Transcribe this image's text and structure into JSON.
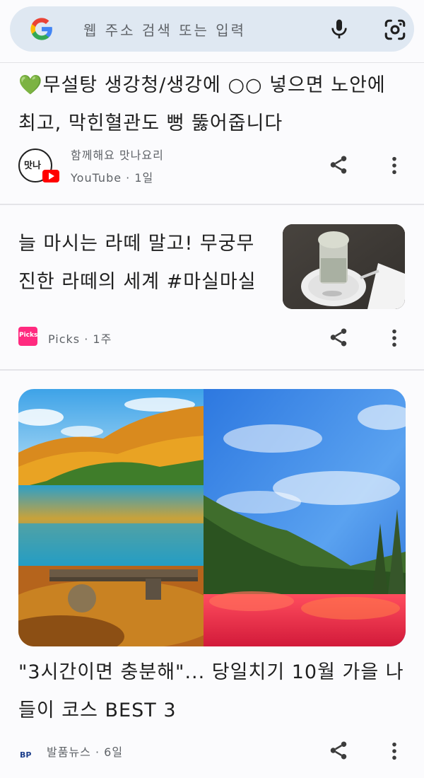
{
  "search": {
    "placeholder": "웹 주소 검색 또는 입력",
    "logo_icon": "google-g-icon",
    "mic_icon": "microphone-icon",
    "lens_icon": "camera-lens-icon"
  },
  "feed": [
    {
      "headline": "💚무설탕 생강청/생강에 ○○ 넣으면 노안에 최고, 막힌혈관도 뻥 뚫어줍니다",
      "headline_line1": "💚무설탕 생강청/생강에 ○○ 넣으면 노안에",
      "headline_line2": "최고, 막힌혈관도 뻥 뚫어줍니다",
      "channel": "함께해요 맛나요리",
      "source": "YouTube",
      "age": "1일",
      "logo_text": "맛나",
      "share_icon": "share-icon",
      "more_icon": "more-vert-icon"
    },
    {
      "headline_line1": "늘 마시는 라떼 말고! 무궁무",
      "headline_line2": "진한 라떼의 세계 #마실마실",
      "source": "Picks",
      "age": "1주",
      "logo_text": "Picks",
      "share_icon": "share-icon",
      "more_icon": "more-vert-icon"
    },
    {
      "headline_line1": "\"3시간이면 충분해\"... 당일치기 10월 가을 나",
      "headline_line2": "들이 코스 BEST 3",
      "source": "발품뉴스",
      "age": "6일",
      "logo_text": "BP",
      "share_icon": "share-icon",
      "more_icon": "more-vert-icon"
    }
  ],
  "colors": {
    "search_bg": "#dfe8f2",
    "picks_pink": "#ff2a7f",
    "youtube_red": "#ff0000"
  }
}
